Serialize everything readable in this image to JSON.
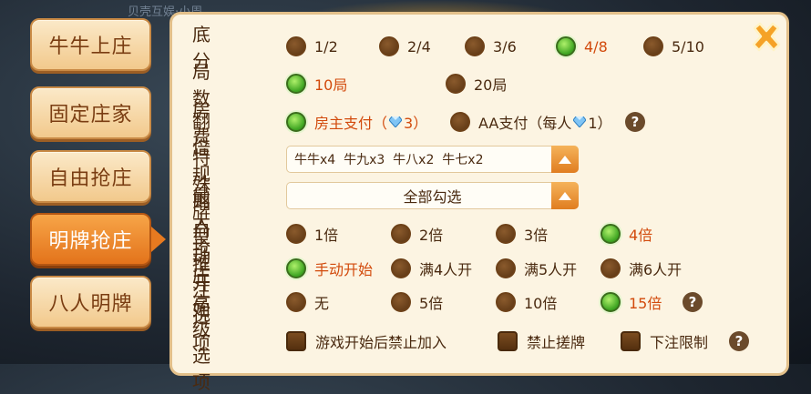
{
  "background": {
    "title": "贝壳互娱·小周"
  },
  "sidebar": {
    "tabs": [
      {
        "label": "牛牛上庄",
        "active": false
      },
      {
        "label": "固定庄家",
        "active": false
      },
      {
        "label": "自由抢庄",
        "active": false
      },
      {
        "label": "明牌抢庄",
        "active": true
      },
      {
        "label": "八人明牌",
        "active": false
      }
    ]
  },
  "colors": {
    "accent": "#e3731b",
    "selected_text": "#d24a0c",
    "radio_on": "#3da421",
    "panel_bg": "#fcf4e2"
  },
  "rows": {
    "base_score": {
      "label": "底分",
      "options": [
        "1/2",
        "2/4",
        "3/6",
        "4/8",
        "5/10"
      ],
      "selected": "4/8"
    },
    "rounds": {
      "label": "局数",
      "options": [
        "10局",
        "20局"
      ],
      "selected": "10局"
    },
    "room_fee": {
      "label": "房费",
      "owner_pay": "房主支付（",
      "owner_pay_count": "3）",
      "aa_pay": "AA支付（每人",
      "aa_pay_count": "1）",
      "selected": "房主支付",
      "diamond_icon": "diamond-icon",
      "help_icon": "help-icon"
    },
    "multiplier": {
      "label": "翻倍规则",
      "value": "牛牛x4  牛九x3  牛八x2  牛七x2"
    },
    "special": {
      "label": "特殊牌型",
      "value": "全部勾选"
    },
    "max_bid": {
      "label": "最大抢庄",
      "options": [
        "1倍",
        "2倍",
        "3倍",
        "4倍"
      ],
      "selected": "4倍"
    },
    "auto_start": {
      "label": "自动开始",
      "options": [
        "手动开始",
        "满4人开",
        "满5人开",
        "满6人开"
      ],
      "selected": "手动开始"
    },
    "bet": {
      "label": "推注选项",
      "options": [
        "无",
        "5倍",
        "10倍",
        "15倍"
      ],
      "selected": "15倍"
    },
    "advanced": {
      "label": "高级选项",
      "options": [
        "游戏开始后禁止加入",
        "禁止搓牌",
        "下注限制"
      ]
    }
  },
  "help_mark": "?"
}
